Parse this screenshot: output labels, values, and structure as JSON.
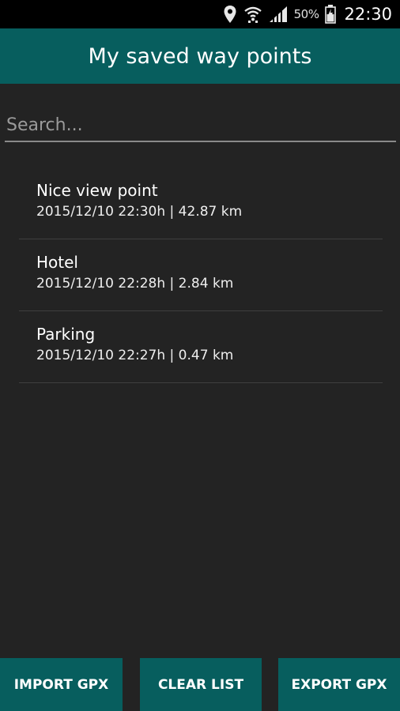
{
  "status_bar": {
    "icons": [
      "location-pin-icon",
      "wifi-icon",
      "signal-icon",
      "battery-icon"
    ],
    "battery_percent": "50%",
    "time": "22:30"
  },
  "app_bar": {
    "title": "My saved way points"
  },
  "search": {
    "placeholder": "Search...",
    "value": ""
  },
  "waypoints": [
    {
      "name": "Nice view point",
      "details": "2015/12/10 22:30h  |  42.87 km"
    },
    {
      "name": "Hotel",
      "details": "2015/12/10 22:28h  |  2.84 km"
    },
    {
      "name": "Parking",
      "details": "2015/12/10 22:27h  |  0.47 km"
    }
  ],
  "buttons": {
    "import_label": "IMPORT GPX",
    "clear_label": "CLEAR LIST",
    "export_label": "EXPORT GPX"
  },
  "colors": {
    "accent": "#075e5e",
    "background": "#232323",
    "status_bar": "#000000"
  }
}
